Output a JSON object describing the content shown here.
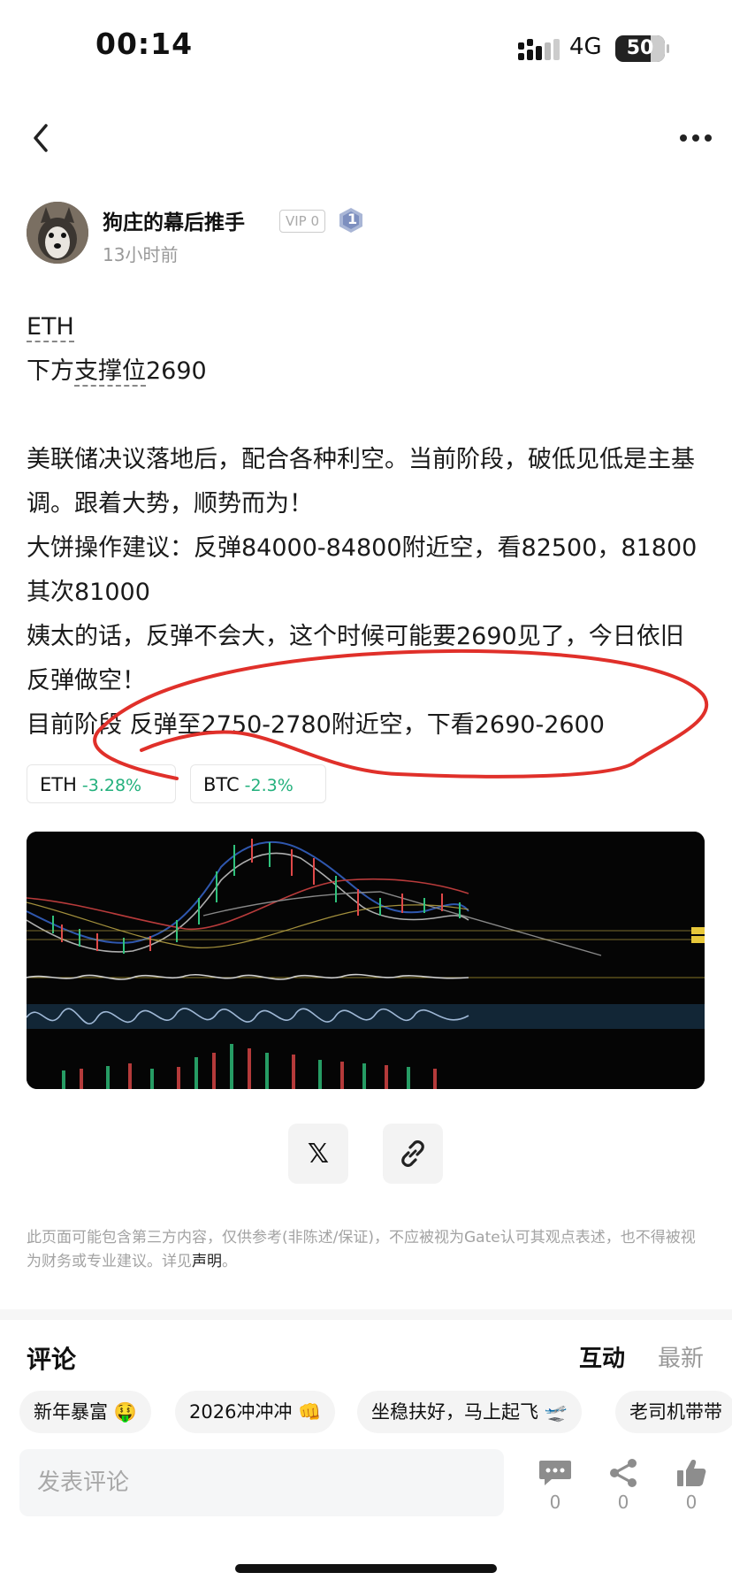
{
  "status_bar": {
    "time": "00:14",
    "network": "4G",
    "battery": "50"
  },
  "author": {
    "name": "狗庄的幕后推手",
    "vip": "VIP 0",
    "level": "1",
    "time_ago": "13小时前"
  },
  "post": {
    "line1": "ETH",
    "line2_prefix": "下方",
    "line2_link": "支撑位",
    "line2_suffix": "2690",
    "para1": "美联储决议落地后，配合各种利空。当前阶段，破低见低是主基调。跟着大势，顺势而为！",
    "para2": "大饼操作建议：反弹84000-84800附近空，看82500，81800其次81000",
    "para3": "姨太的话，反弹不会大，这个时候可能要2690见了，今日依旧反弹做空！",
    "para4": "目前阶段 反弹至2750-2780附近空，下看2690-2600"
  },
  "tickers": [
    {
      "symbol": "ETH",
      "change": "-3.28%"
    },
    {
      "symbol": "BTC",
      "change": "-2.3%"
    }
  ],
  "share": {
    "x_label": "𝕏"
  },
  "disclaimer": {
    "text": "此页面可能包含第三方内容，仅供参考(非陈述/保证)，不应被视为Gate认可其观点表述，也不得被视为财务或专业建议。详见",
    "link": "声明",
    "end": "。"
  },
  "comments": {
    "title": "评论",
    "sort_active": "互动",
    "sort_inactive": "最新",
    "chips": [
      "新年暴富 🤑",
      "2026冲冲冲 👊",
      "坐稳扶好，马上起飞 🛫",
      "老司机带带"
    ],
    "input_placeholder": "发表评论",
    "actions": [
      {
        "icon": "comment-icon",
        "count": "0"
      },
      {
        "icon": "share-icon",
        "count": "0"
      },
      {
        "icon": "like-icon",
        "count": "0"
      }
    ]
  },
  "colors": {
    "positive": "#22b07c",
    "annotation": "#e0302a",
    "chart_bg": "#050505"
  }
}
